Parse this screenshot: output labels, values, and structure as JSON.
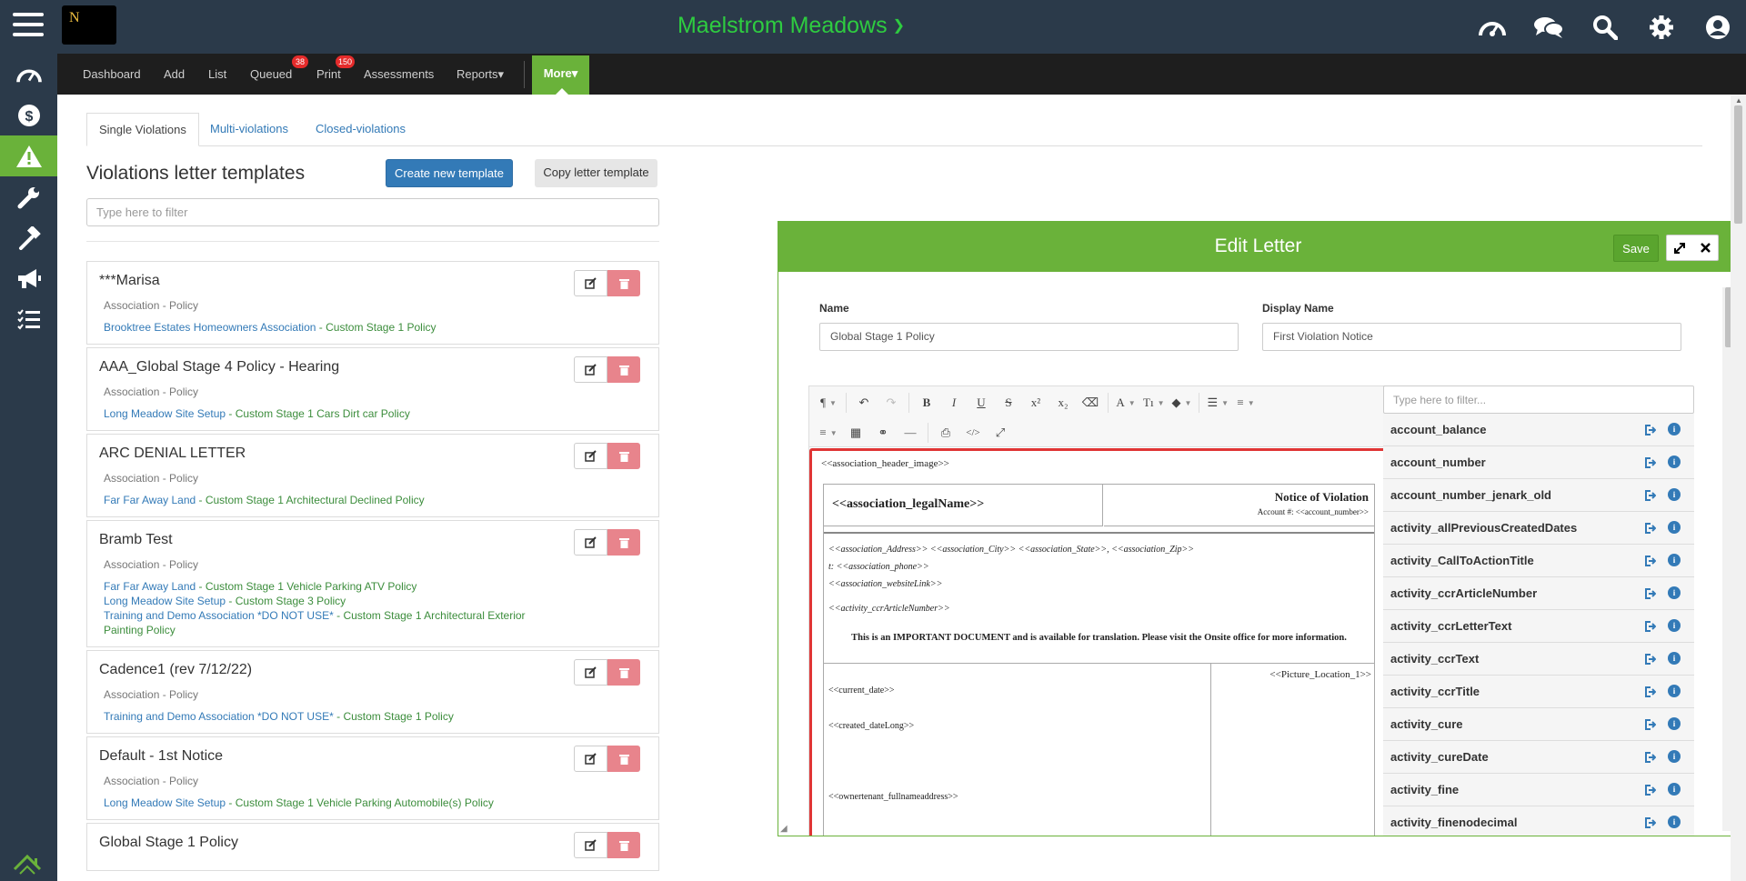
{
  "app": {
    "logo_letter": "N",
    "community": "Maelstrom Meadows"
  },
  "icons": {
    "menu": "hamburger-icon",
    "top": [
      "dashboard-gauge-icon",
      "chat-icon",
      "search-icon",
      "gear-icon",
      "user-icon"
    ],
    "sidebar": [
      "gauge-icon",
      "dollar-icon",
      "warning-icon",
      "wrench-icon",
      "hammer-icon",
      "megaphone-icon",
      "checklist-icon"
    ],
    "bottom": "house-logo-icon"
  },
  "colors": {
    "brand_green": "#6ab23a",
    "title_green": "#2ecc40",
    "topbar": "#2b3a4a",
    "navbar": "#1e1e1e",
    "link_blue": "#337ab7",
    "highlight_red": "#e03535"
  },
  "nav": {
    "items": [
      {
        "label": "Dashboard"
      },
      {
        "label": "Add"
      },
      {
        "label": "List"
      },
      {
        "label": "Queued",
        "badge": "38"
      },
      {
        "label": "Print",
        "badge": "150"
      },
      {
        "label": "Assessments"
      },
      {
        "label": "Reports▾"
      }
    ],
    "more": "More▾"
  },
  "tabs": [
    {
      "label": "Single Violations",
      "active": true
    },
    {
      "label": "Multi-violations"
    },
    {
      "label": "Closed-violations"
    }
  ],
  "page": {
    "title": "Violations letter templates",
    "create_btn": "Create new template",
    "copy_btn": "Copy letter template",
    "filter_placeholder": "Type here to filter"
  },
  "templates": [
    {
      "name": "***Marisa",
      "type": "Association - Policy",
      "links": [
        {
          "assoc": "Brooktree Estates Homeowners Association",
          "rest": " - Custom Stage 1 Policy"
        }
      ]
    },
    {
      "name": "AAA_Global Stage 4 Policy - Hearing",
      "type": "Association - Policy",
      "links": [
        {
          "assoc": "Long Meadow Site Setup",
          "rest": " - Custom Stage 1 Cars Dirt car Policy"
        }
      ]
    },
    {
      "name": "ARC DENIAL LETTER",
      "type": "Association - Policy",
      "links": [
        {
          "assoc": "Far Far Away Land",
          "rest": " - Custom Stage 1 Architectural Declined Policy"
        }
      ]
    },
    {
      "name": "Bramb Test",
      "type": "Association - Policy",
      "links": [
        {
          "assoc": "Far Far Away Land",
          "rest": " - Custom Stage 1 Vehicle Parking ATV Policy"
        },
        {
          "assoc": "Long Meadow Site Setup",
          "rest": " - Custom Stage 3 Policy"
        },
        {
          "assoc": "Training and Demo Association *DO NOT USE*",
          "rest": " - Custom Stage 1 Architectural Exterior Painting Policy"
        }
      ]
    },
    {
      "name": "Cadence1 (rev 7/12/22)",
      "type": "Association - Policy",
      "links": [
        {
          "assoc": "Training and Demo Association *DO NOT USE*",
          "rest": " - Custom Stage 1 Policy"
        }
      ]
    },
    {
      "name": "Default - 1st Notice",
      "type": "Association - Policy",
      "links": [
        {
          "assoc": "Long Meadow Site Setup",
          "rest": " - Custom Stage 1 Vehicle Parking Automobile(s) Policy"
        }
      ]
    },
    {
      "name": "Global Stage 1 Policy",
      "type": "",
      "links": []
    }
  ],
  "editor_panel": {
    "title": "Edit Letter",
    "save": "Save",
    "name_label": "Name",
    "name_value": "Global Stage 1  Policy",
    "display_label": "Display Name",
    "display_value": "First Violation Notice"
  },
  "toolbar": {
    "row1": [
      "¶",
      "↶",
      "↷",
      "B",
      "I",
      "U",
      "S",
      "x²",
      "x₂",
      "⌫",
      "A",
      "Tı",
      "◆",
      "☰",
      "≡"
    ],
    "row2": [
      "≡",
      "▦",
      "⚭",
      "—",
      "⎙",
      "</>",
      "⤢"
    ]
  },
  "letter": {
    "header_image": "<<association_header_image>>",
    "legal_name": "<<association_legalName>>",
    "notice_title": "Notice of Violation",
    "account": "Account #: <<account_number>>",
    "address": "<<association_Address>> <<association_City>> <<association_State>>, <<association_Zip>>",
    "phone": "t: <<association_phone>>",
    "website": "<<association_websiteLink>>",
    "article": "<<activity_ccrArticleNumber>>",
    "important": "This is an IMPORTANT DOCUMENT and is available for translation. Please visit the Onsite office for more information.",
    "picture": "<<Picture_Location_1>>",
    "current_date": "<<current_date>>",
    "created_date": "<<created_dateLong>>",
    "owner_address": "<<ownertenant_fullnameaddress>>"
  },
  "variables": {
    "filter_placeholder": "Type here to filter...",
    "items": [
      "account_balance",
      "account_number",
      "account_number_jenark_old",
      "activity_allPreviousCreatedDates",
      "activity_CallToActionTitle",
      "activity_ccrArticleNumber",
      "activity_ccrLetterText",
      "activity_ccrText",
      "activity_ccrTitle",
      "activity_cure",
      "activity_cureDate",
      "activity_fine",
      "activity_finenodecimal"
    ]
  }
}
